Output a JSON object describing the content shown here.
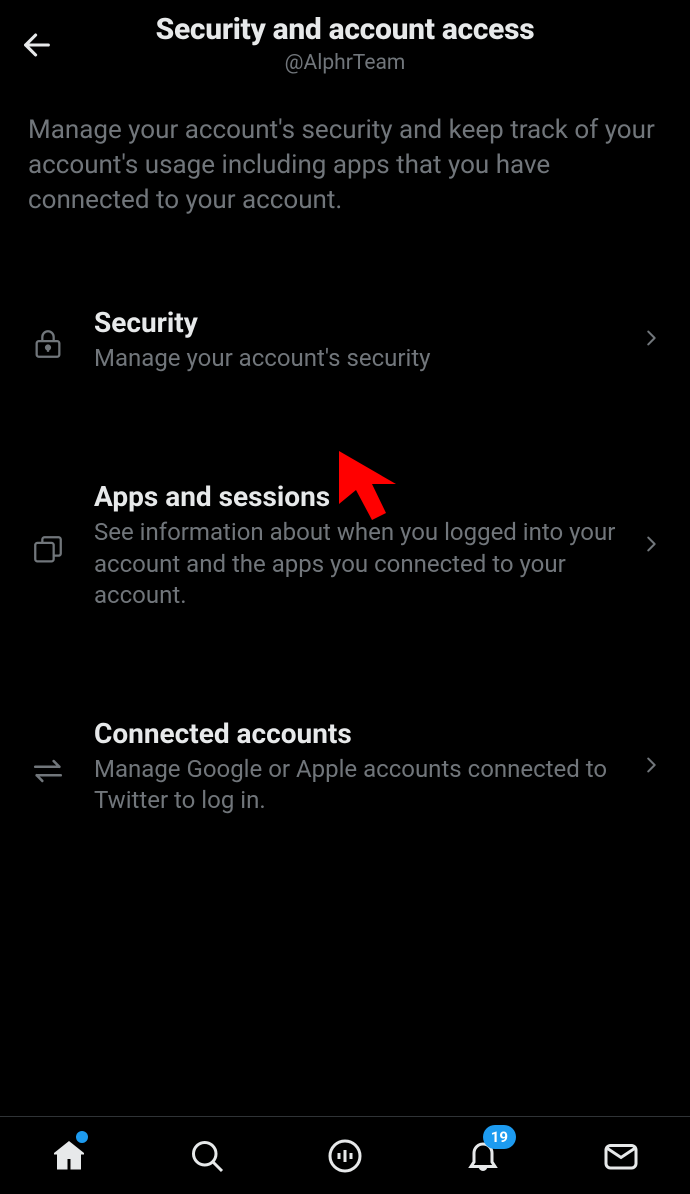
{
  "header": {
    "title": "Security and account access",
    "username": "@AlphrTeam"
  },
  "description": "Manage your account's security and keep track of your account's usage including apps that you have connected to your account.",
  "settings": [
    {
      "title": "Security",
      "subtitle": "Manage your account's security"
    },
    {
      "title": "Apps and sessions",
      "subtitle": "See information about when you logged into your account and the apps you connected to your account."
    },
    {
      "title": "Connected accounts",
      "subtitle": "Manage Google or Apple accounts connected to Twitter to log in."
    }
  ],
  "nav": {
    "badge_count": "19"
  }
}
